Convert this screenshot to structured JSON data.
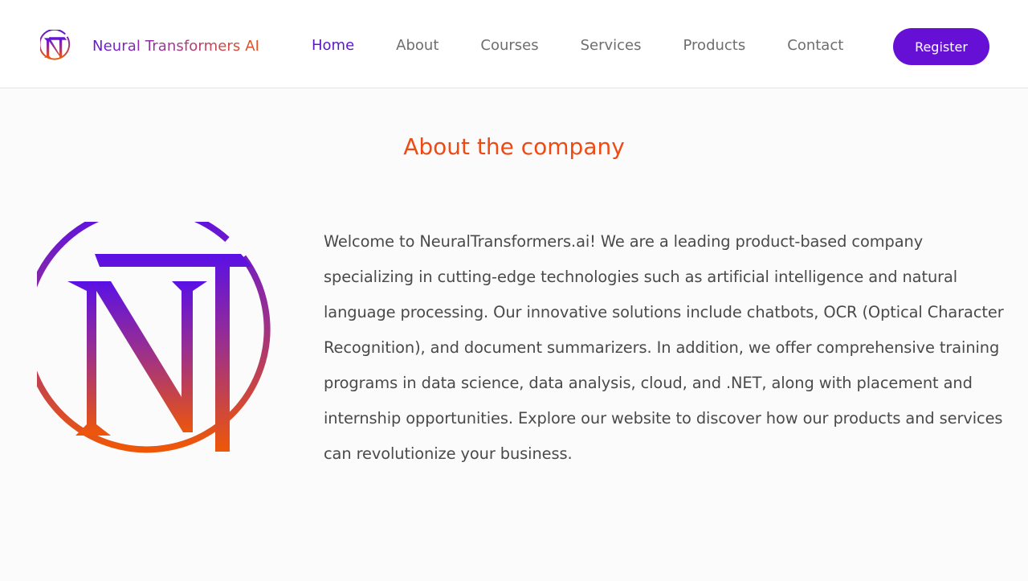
{
  "brand": {
    "name": "Neural Transformers AI",
    "logo_icon": "nt-monogram-logo-icon",
    "gradient": [
      "#6419d8",
      "#e5531b"
    ]
  },
  "nav": {
    "items": [
      {
        "label": "Home",
        "active": true
      },
      {
        "label": "About",
        "active": false
      },
      {
        "label": "Courses",
        "active": false
      },
      {
        "label": "Services",
        "active": false
      },
      {
        "label": "Products",
        "active": false
      },
      {
        "label": "Contact",
        "active": false
      }
    ],
    "register_label": "Register"
  },
  "about": {
    "title": "About the company",
    "body": "Welcome to NeuralTransformers.ai! We are a leading product-based company specializing in cutting-edge technologies such as artificial intelligence and natural language processing. Our innovative solutions include chatbots, OCR (Optical Character Recognition), and document summarizers. In addition, we offer comprehensive training programs in data science, data analysis, cloud, and .NET, along with placement and internship opportunities. Explore our website to discover how our products and services can revolutionize your business."
  },
  "colors": {
    "accent": "#6610d6",
    "title_orange": "#ee4b14",
    "text": "#4a4a4a",
    "nav_text": "#6e6e6e"
  }
}
